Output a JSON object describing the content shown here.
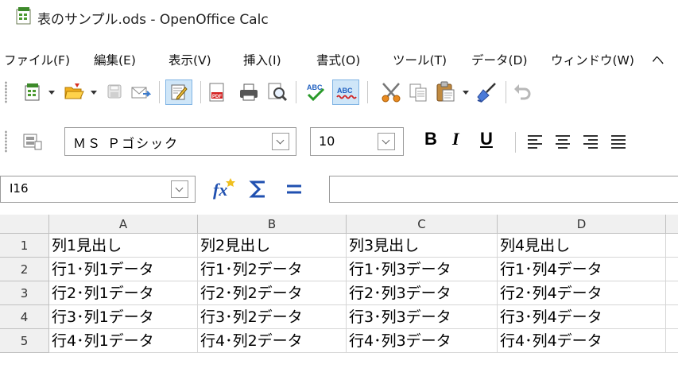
{
  "window": {
    "title": "表のサンプル.ods - OpenOffice Calc"
  },
  "menu": [
    "ファイル(F)",
    "編集(E)",
    "表示(V)",
    "挿入(I)",
    "書式(O)",
    "ツール(T)",
    "データ(D)",
    "ウィンドウ(W)",
    "ヘ"
  ],
  "toolbar": {
    "icons": [
      "new-document-icon",
      "open-folder-icon",
      "save-icon",
      "email-icon",
      "edit-mode-icon",
      "export-pdf-icon",
      "print-icon",
      "page-preview-icon",
      "spellcheck-icon",
      "auto-spellcheck-icon",
      "cut-icon",
      "copy-icon",
      "paste-icon",
      "clone-format-icon",
      "undo-icon"
    ]
  },
  "format": {
    "font_name": "ＭＳ Ｐゴシック",
    "font_size": "10",
    "bold": "B",
    "italic": "I",
    "underline": "U"
  },
  "formula_bar": {
    "cell_ref": "I16",
    "value": ""
  },
  "sheet": {
    "columns": [
      "A",
      "B",
      "C",
      "D"
    ],
    "rows": [
      {
        "num": "1",
        "cells": [
          "列1見出し",
          "列2見出し",
          "列3見出し",
          "列4見出し"
        ]
      },
      {
        "num": "2",
        "cells": [
          "行1･列1データ",
          "行1･列2データ",
          "行1･列3データ",
          "行1･列4データ"
        ]
      },
      {
        "num": "3",
        "cells": [
          "行2･列1データ",
          "行2･列2データ",
          "行2･列3データ",
          "行2･列4データ"
        ]
      },
      {
        "num": "4",
        "cells": [
          "行3･列1データ",
          "行3･列2データ",
          "行3･列3データ",
          "行3･列4データ"
        ]
      },
      {
        "num": "5",
        "cells": [
          "行4･列1データ",
          "行4･列2データ",
          "行4･列3データ",
          "行4･列4データ"
        ]
      }
    ]
  },
  "colors": {
    "edit_highlight": "#cfe6f8",
    "spell_blue": "#2060c0",
    "spell_red": "#d02020"
  }
}
